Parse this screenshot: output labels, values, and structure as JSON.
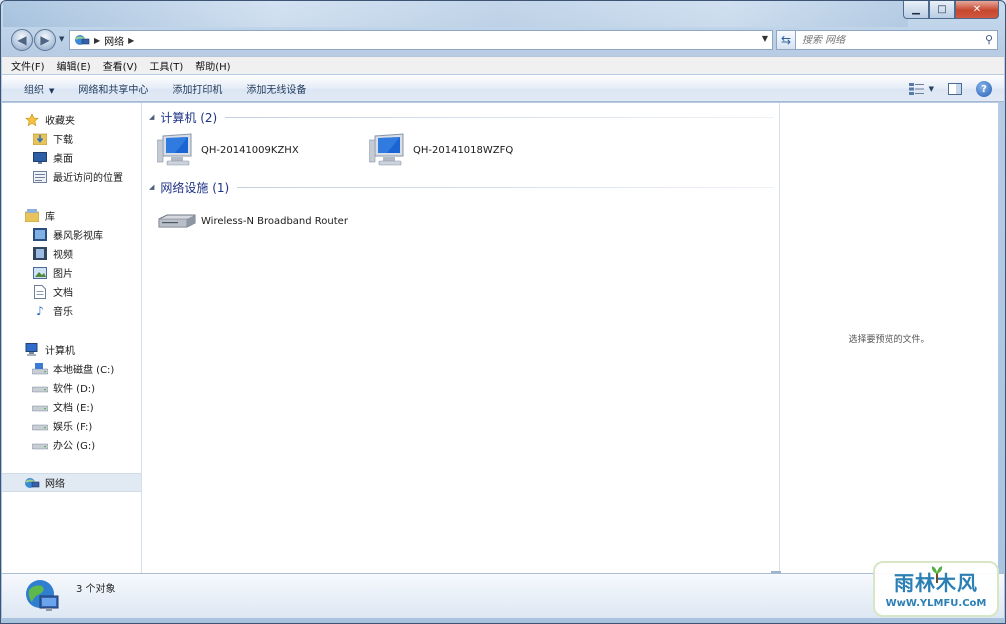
{
  "window": {
    "caption": {
      "minimize": "▁",
      "maximize": "□",
      "close": "✕"
    }
  },
  "nav": {
    "address_crumb": "网络",
    "search_placeholder": "搜索 网络"
  },
  "menubar": {
    "items": [
      "文件(F)",
      "编辑(E)",
      "查看(V)",
      "工具(T)",
      "帮助(H)"
    ]
  },
  "commandbar": {
    "organize": "组织",
    "items": [
      "网络和共享中心",
      "添加打印机",
      "添加无线设备"
    ],
    "help": "?"
  },
  "navpane": {
    "favorites": {
      "label": "收藏夹",
      "items": [
        "下载",
        "桌面",
        "最近访问的位置"
      ]
    },
    "libraries": {
      "label": "库",
      "items": [
        "暴风影视库",
        "视频",
        "图片",
        "文档",
        "音乐"
      ]
    },
    "computer": {
      "label": "计算机",
      "items": [
        "本地磁盘 (C:)",
        "软件 (D:)",
        "文档 (E:)",
        "娱乐 (F:)",
        "办公 (G:)"
      ]
    },
    "network": {
      "label": "网络"
    }
  },
  "files": {
    "groups": [
      {
        "title": "计算机 (2)",
        "items": [
          "QH-20141009KZHX",
          "QH-20141018WZFQ"
        ]
      },
      {
        "title": "网络设施 (1)",
        "items": [
          "Wireless-N Broadband Router"
        ]
      }
    ]
  },
  "preview": {
    "text": "选择要预览的文件。"
  },
  "details": {
    "text": "3 个对象"
  },
  "watermark": {
    "title": "雨林木风",
    "url": "WwW.YLMFU.CoM"
  },
  "colors": {
    "group_header": "#1e3287",
    "selection": "#e1e9f2"
  }
}
